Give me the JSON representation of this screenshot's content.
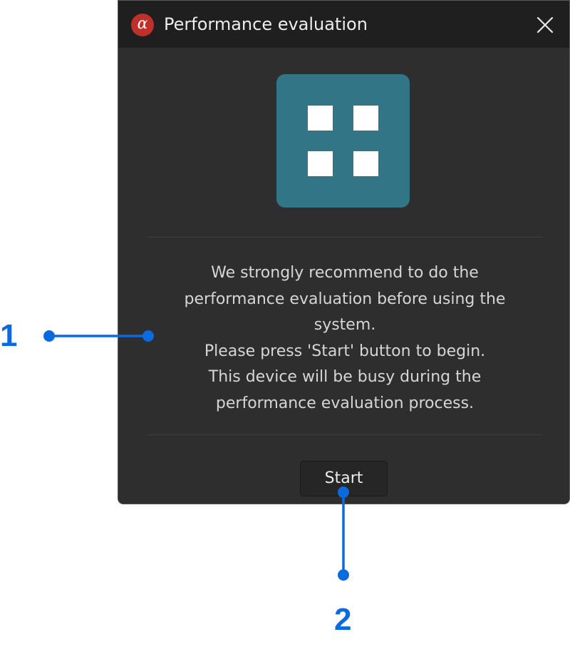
{
  "dialog": {
    "title": "Performance evaluation",
    "logo_glyph": "α",
    "close_icon": "close-icon",
    "hero_icon": "grid-icon",
    "hero_color": "#317587",
    "message_lines": [
      "We strongly recommend to do the",
      "performance evaluation before using the",
      "system.",
      "Please press 'Start' button to begin.",
      "This device will be busy during the",
      "performance evaluation process."
    ],
    "start_label": "Start"
  },
  "callouts": {
    "one": "1",
    "two": "2",
    "color": "#0a6be0"
  }
}
